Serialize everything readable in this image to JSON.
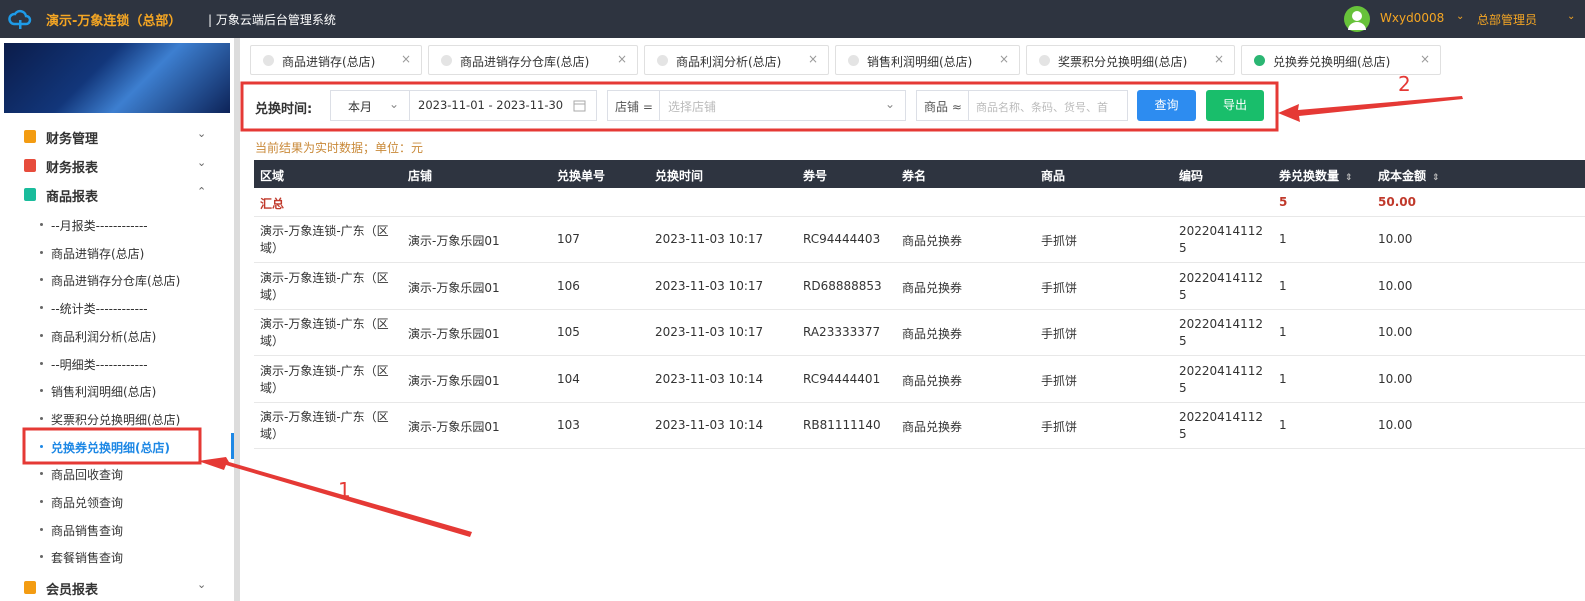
{
  "header": {
    "app_title": "演示-万象连锁（总部）",
    "system_title": "| 万象云端后台管理系统",
    "user_name": "Wxyd0008",
    "role": "总部管理员",
    "caret": "⌄"
  },
  "sidebar": {
    "groups": [
      {
        "label": "财务管理",
        "chevron": "⌄",
        "icon_color": "#f39c12"
      },
      {
        "label": "财务报表",
        "chevron": "⌄",
        "icon_color": "#e74c3c"
      },
      {
        "label": "商品报表",
        "chevron": "⌃",
        "icon_color": "#1abc9c"
      },
      {
        "label": "会员报表",
        "chevron": "⌄",
        "icon_color": "#f39c12"
      }
    ],
    "items": [
      "--月报类------------",
      "商品进销存(总店)",
      "商品进销存分仓库(总店)",
      "--统计类------------",
      "商品利润分析(总店)",
      "--明细类------------",
      "销售利润明细(总店)",
      "奖票积分兑换明细(总店)",
      "兑换券兑换明细(总店)",
      "商品回收查询",
      "商品兑领查询",
      "商品销售查询",
      "套餐销售查询"
    ],
    "active_index": 8
  },
  "tabs": [
    {
      "label": "商品进销存(总店)",
      "close": "×"
    },
    {
      "label": "商品进销存分仓库(总店)",
      "close": "×"
    },
    {
      "label": "商品利润分析(总店)",
      "close": "×"
    },
    {
      "label": "销售利润明细(总店)",
      "close": "×"
    },
    {
      "label": "奖票积分兑换明细(总店)",
      "close": "×"
    },
    {
      "label": "兑换券兑换明细(总店)",
      "close": "×"
    }
  ],
  "filter": {
    "time_label": "兑换时间:",
    "period_value": "本月",
    "date_range": "2023-11-01 - 2023-11-30",
    "store_label": "店铺 =",
    "store_placeholder": "选择店铺",
    "goods_label": "商品 ≈",
    "goods_placeholder": "商品名称、条码、货号、首",
    "query_label": "查询",
    "export_label": "导出"
  },
  "note": "当前结果为实时数据；单位：元",
  "table": {
    "headers": [
      "区域",
      "店铺",
      "兑换单号",
      "兑换时间",
      "券号",
      "券名",
      "商品",
      "编码",
      "券兑换数量",
      "成本金额"
    ],
    "summary": {
      "label": "汇总",
      "qty": "5",
      "amount": "50.00"
    },
    "rows": [
      {
        "region": "演示-万象连锁-广东（区域）",
        "store": "演示-万象乐园01",
        "order": "107",
        "time": "2023-11-03 10:17",
        "coupon_no": "RC94444403",
        "coupon_name": "商品兑换券",
        "goods": "手抓饼",
        "code": "202204141125",
        "qty": "1",
        "amount": "10.00"
      },
      {
        "region": "演示-万象连锁-广东（区域）",
        "store": "演示-万象乐园01",
        "order": "106",
        "time": "2023-11-03 10:17",
        "coupon_no": "RD68888853",
        "coupon_name": "商品兑换券",
        "goods": "手抓饼",
        "code": "202204141125",
        "qty": "1",
        "amount": "10.00"
      },
      {
        "region": "演示-万象连锁-广东（区域）",
        "store": "演示-万象乐园01",
        "order": "105",
        "time": "2023-11-03 10:17",
        "coupon_no": "RA23333377",
        "coupon_name": "商品兑换券",
        "goods": "手抓饼",
        "code": "202204141125",
        "qty": "1",
        "amount": "10.00"
      },
      {
        "region": "演示-万象连锁-广东（区域）",
        "store": "演示-万象乐园01",
        "order": "104",
        "time": "2023-11-03 10:14",
        "coupon_no": "RC94444401",
        "coupon_name": "商品兑换券",
        "goods": "手抓饼",
        "code": "202204141125",
        "qty": "1",
        "amount": "10.00"
      },
      {
        "region": "演示-万象连锁-广东（区域）",
        "store": "演示-万象乐园01",
        "order": "103",
        "time": "2023-11-03 10:14",
        "coupon_no": "RB81111140",
        "coupon_name": "商品兑换券",
        "goods": "手抓饼",
        "code": "202204141125",
        "qty": "1",
        "amount": "10.00"
      }
    ]
  },
  "annotations": {
    "label_1": "1",
    "label_2": "2",
    "color": "#e53935"
  }
}
